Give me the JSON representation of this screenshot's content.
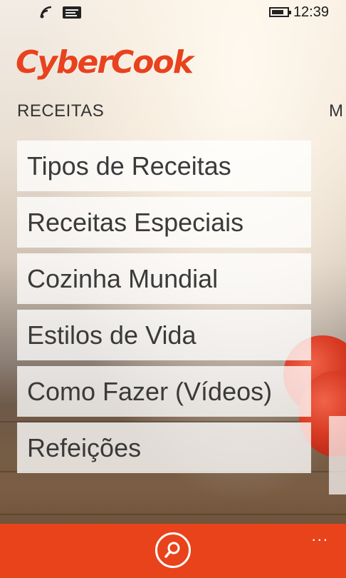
{
  "status_bar": {
    "time": "12:39"
  },
  "app": {
    "logo_text": "CyberCook"
  },
  "pivot": {
    "title": "RECEITAS",
    "next_title_peek": "M"
  },
  "menu": {
    "items": [
      {
        "label": "Tipos de Receitas"
      },
      {
        "label": "Receitas Especiais"
      },
      {
        "label": "Cozinha Mundial"
      },
      {
        "label": "Estilos de Vida"
      },
      {
        "label": "Como Fazer (Vídeos)"
      },
      {
        "label": "Refeições"
      }
    ]
  },
  "app_bar": {
    "more_label": "..."
  },
  "colors": {
    "brand": "#e8421e",
    "app_bar": "#e8431b"
  },
  "icons": [
    "signal-icon",
    "message-icon",
    "battery-icon",
    "search-icon"
  ]
}
